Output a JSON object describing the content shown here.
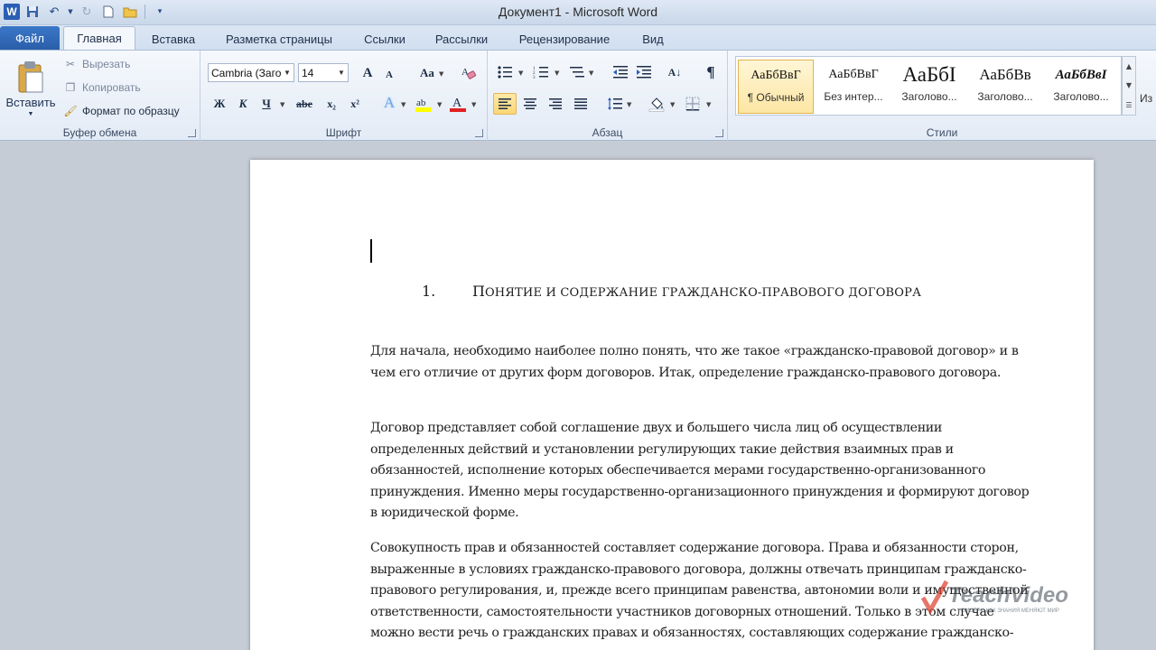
{
  "window": {
    "title": "Документ1  -  Microsoft Word",
    "logo_letter": "W"
  },
  "tabs": {
    "file": "Файл",
    "items": [
      "Главная",
      "Вставка",
      "Разметка страницы",
      "Ссылки",
      "Рассылки",
      "Рецензирование",
      "Вид"
    ]
  },
  "clipboard": {
    "paste": "Вставить",
    "cut": "Вырезать",
    "copy": "Копировать",
    "format_painter": "Формат по образцу",
    "label": "Буфер обмена"
  },
  "font": {
    "name": "Cambria (Заго",
    "size": "14",
    "label": "Шрифт",
    "grow": "A",
    "shrink": "A",
    "case": "Aa",
    "bold": "Ж",
    "italic": "К",
    "underline": "Ч",
    "strike": "abe",
    "subscript": "x₂",
    "superscript": "x²",
    "effects": "A",
    "color": "A",
    "highlight_color": "#ffff00",
    "font_color": "#e02020"
  },
  "paragraph": {
    "label": "Абзац"
  },
  "styles": {
    "label": "Стили",
    "change_label": "Из с",
    "items": [
      {
        "sample": "АаБбВвГ",
        "name": "¶ Обычный"
      },
      {
        "sample": "АаБбВвГ",
        "name": "Без интер..."
      },
      {
        "sample": "АаБбI",
        "name": "Заголово..."
      },
      {
        "sample": "АаБбВв",
        "name": "Заголово..."
      },
      {
        "sample": "АаБбВвІ",
        "name": "Заголово..."
      }
    ]
  },
  "document": {
    "heading_number": "1.",
    "heading_first": "П",
    "heading_rest": "ОНЯТИЕ И СОДЕРЖАНИЕ ГРАЖДАНСКО-ПРАВОВОГО ДОГОВОРА",
    "paragraphs": [
      "Для начала, необходимо наиболее полно понять, что же такое «гражданско-правовой договор» и в чем его отличие от других форм договоров. Итак, определение гражданско-правового договора.",
      "Договор представляет собой соглашение двух и большего числа лиц об осуществлении определенных действий и установлении регулирующих такие действия взаимных прав и обязанностей, исполнение которых обеспечивается мерами государственно-организованного принуждения. Именно меры государственно-организационного принуждения и формируют договор в юридической форме.",
      "Совокупность прав и обязанностей составляет содержание договора. Права и обязанности сторон, выраженные в условиях гражданско-правового договора, должны отвечать принципам гражданско-правового регулирования, и, прежде всего принципам равенства, автономии воли и имущественной ответственности, самостоятельности участников договорных отношений. Только в этом случае можно вести речь о гражданских правах и обязанностях, составляющих содержание гражданско-правового договора."
    ]
  },
  "watermark": {
    "brand": "TeachVideo",
    "tagline": "СМОТРИ КАК ЗНАНИЯ МЕНЯЮТ МИР"
  }
}
